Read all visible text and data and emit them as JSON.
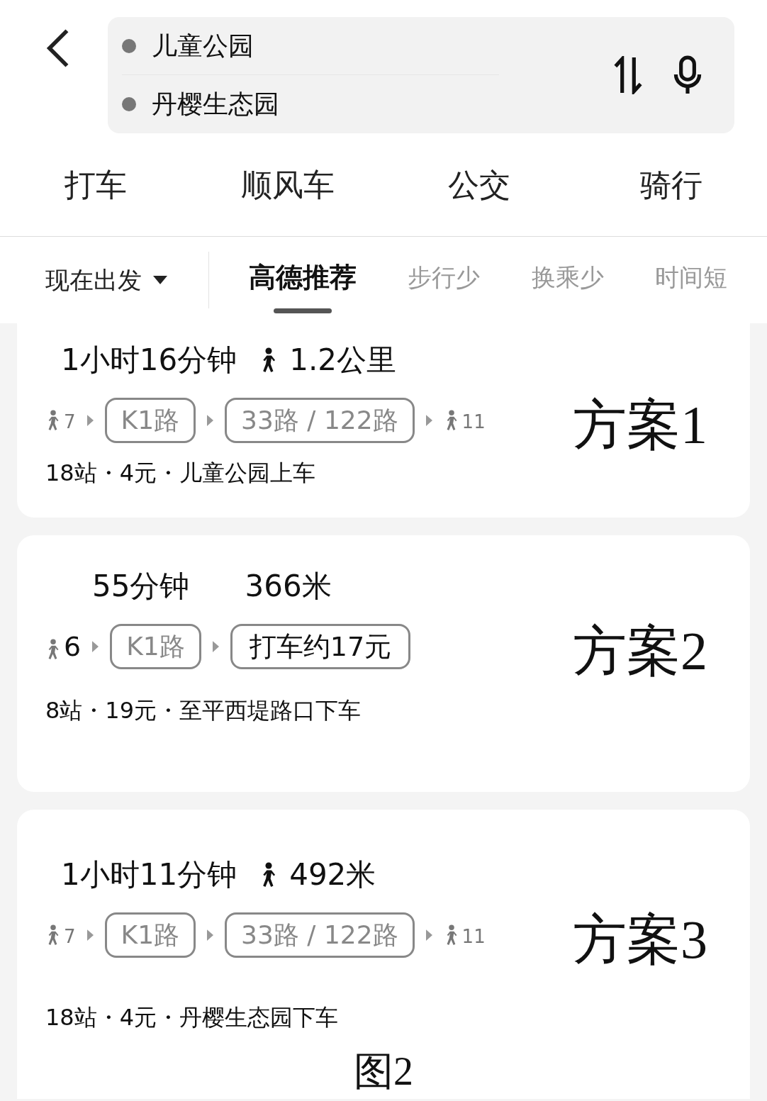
{
  "route_inputs": {
    "origin": "儿童公园",
    "destination": "丹樱生态园"
  },
  "modes": [
    "打车",
    "顺风车",
    "公交",
    "骑行"
  ],
  "depart": "现在出发",
  "sort_tabs": [
    {
      "label": "高德推荐",
      "selected": true
    },
    {
      "label": "步行少",
      "selected": false
    },
    {
      "label": "换乘少",
      "selected": false
    },
    {
      "label": "时间短",
      "selected": false
    }
  ],
  "plans": [
    {
      "duration": "1小时16分钟",
      "walk_icon": true,
      "distance": "1.2公里",
      "steps": [
        {
          "kind": "walk",
          "text": "7"
        },
        {
          "kind": "line",
          "text": "K1路"
        },
        {
          "kind": "line",
          "text": "33路 / 122路"
        },
        {
          "kind": "walk",
          "text": "11"
        }
      ],
      "info": "18站・4元・儿童公园上车",
      "label": "方案1"
    },
    {
      "duration": "55分钟",
      "walk_icon": false,
      "distance": "366米",
      "steps": [
        {
          "kind": "walk",
          "text": "6"
        },
        {
          "kind": "line",
          "text": "K1路"
        },
        {
          "kind": "taxi",
          "text": "打车约17元"
        }
      ],
      "info": "8站・19元・至平西堤路口下车",
      "label": "方案2"
    },
    {
      "duration": "1小时11分钟",
      "walk_icon": true,
      "distance": "492米",
      "steps": [
        {
          "kind": "walk",
          "text": "7"
        },
        {
          "kind": "line",
          "text": "K1路"
        },
        {
          "kind": "line",
          "text": "33路 / 122路"
        },
        {
          "kind": "walk",
          "text": "11"
        }
      ],
      "info": "18站・4元・丹樱生态园下车",
      "label": "方案3"
    }
  ],
  "caption": "图2"
}
